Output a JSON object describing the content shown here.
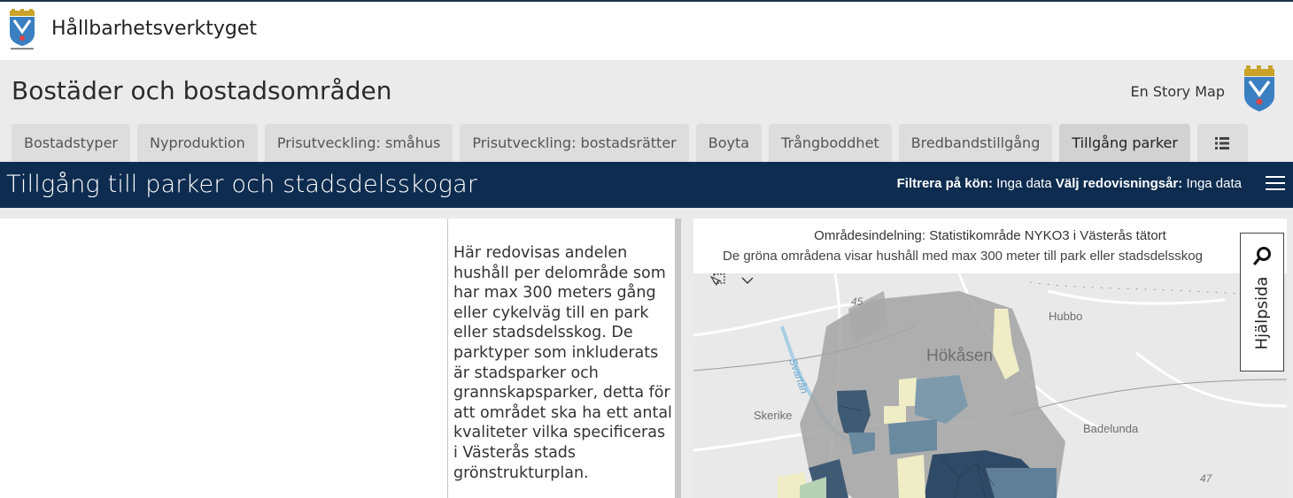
{
  "app": {
    "title": "Hållbarhetsverktyget"
  },
  "story": {
    "title": "Bostäder och bostadsområden",
    "credit": "En Story Map",
    "tabs": [
      {
        "label": "Bostadstyper"
      },
      {
        "label": "Nyproduktion"
      },
      {
        "label": "Prisutveckling: småhus"
      },
      {
        "label": "Prisutveckling: bostadsrätter"
      },
      {
        "label": "Boyta"
      },
      {
        "label": "Trångboddhet"
      },
      {
        "label": "Bredbandstillgång"
      },
      {
        "label": "Tillgång parker",
        "active": true
      }
    ],
    "list_icon": "list-icon"
  },
  "section": {
    "title": "Tillgång till parker och stadsdelsskogar",
    "filter_gender_label": "Filtrera på kön:",
    "filter_gender_value": "Inga data",
    "filter_year_label": "Välj redovisningsår:",
    "filter_year_value": "Inga data"
  },
  "panel": {
    "text": "Här redovisas andelen hushåll per delområde som har max 300 meters gång eller cykelväg till en park eller stadsdelsskog. De parktyper som inkluderats är stadsparker och grannskapsparker, detta för att området ska ha ett antal kvaliteter vilka specificeras i Västerås stads grönstrukturplan."
  },
  "map": {
    "heading": "Områdesindelning: Statistikområde NYKO3 i Västerås tätort",
    "subheading": "De gröna områdena visar hushåll med max 300 meter till park eller stadsdelsskog",
    "labels": {
      "hokasen": "Hökåsen",
      "hubbo": "Hubbo",
      "skerike": "Skerike",
      "badelunda": "Badelunda",
      "svartan": "Svartån",
      "road45": "45",
      "road47": "47"
    }
  },
  "help": {
    "label": "Hjälpsida"
  },
  "colors": {
    "navy": "#0d2c50",
    "header_bg": "#ebebeb",
    "tab_bg": "#dddddd"
  }
}
